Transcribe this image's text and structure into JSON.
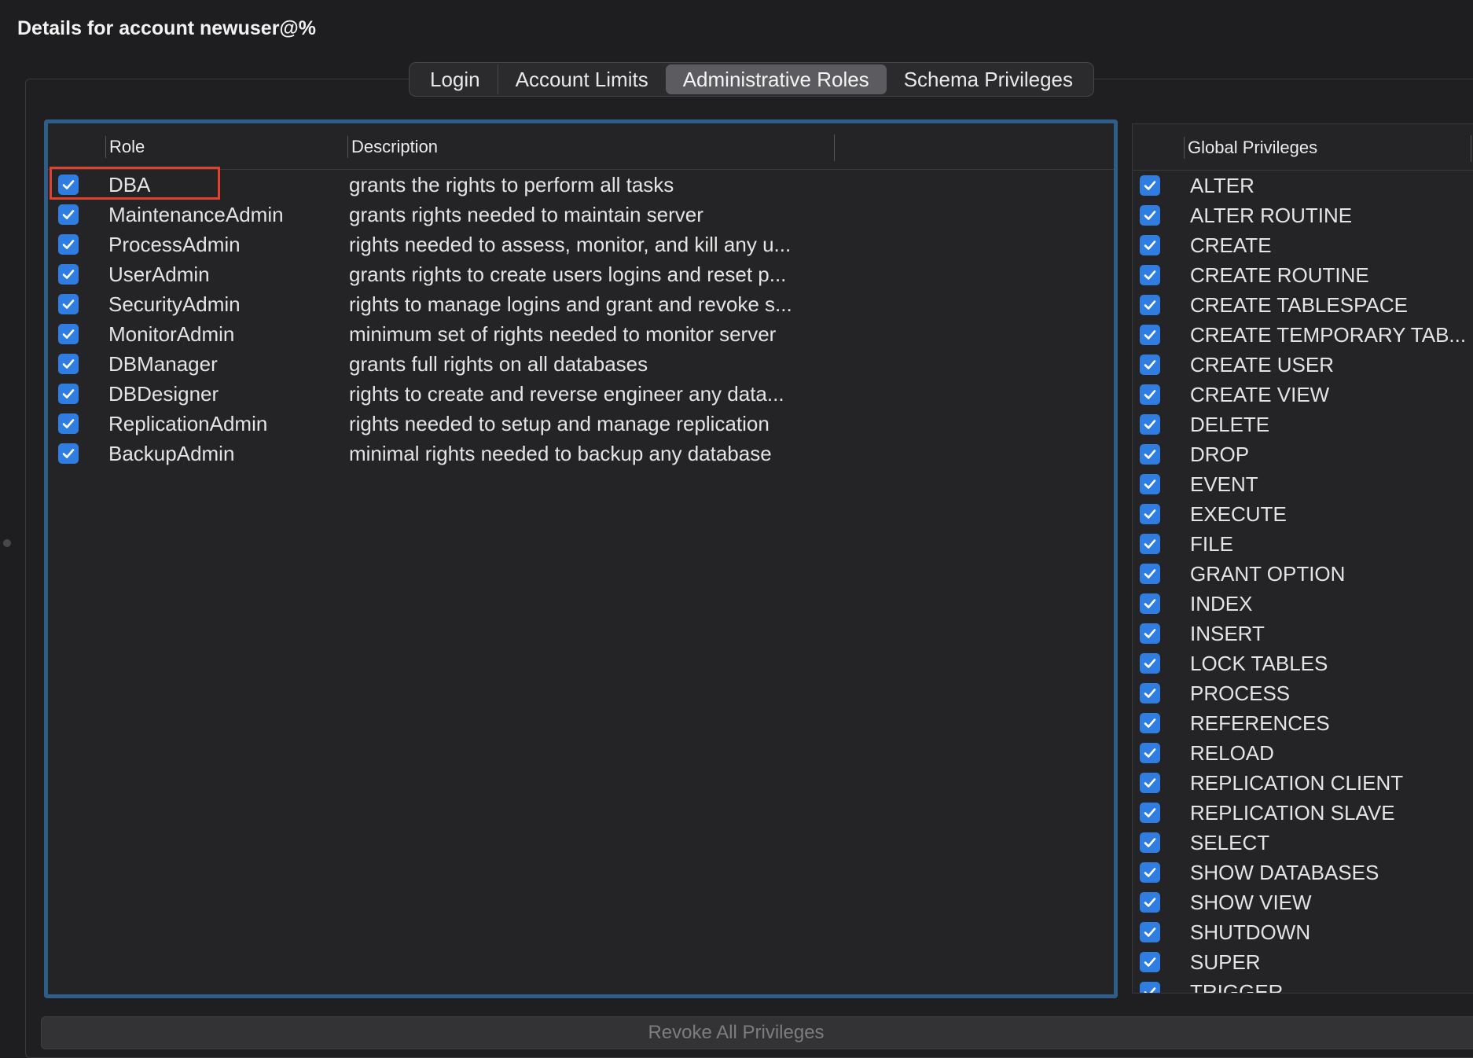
{
  "window": {
    "title": "Details for account newuser@%"
  },
  "tabs": [
    {
      "label": "Login",
      "active": false
    },
    {
      "label": "Account Limits",
      "active": false
    },
    {
      "label": "Administrative Roles",
      "active": true
    },
    {
      "label": "Schema Privileges",
      "active": false
    }
  ],
  "roles_table": {
    "columns": {
      "role": "Role",
      "description": "Description"
    },
    "rows": [
      {
        "checked": true,
        "role": "DBA",
        "description": "grants the rights to perform all tasks"
      },
      {
        "checked": true,
        "role": "MaintenanceAdmin",
        "description": "grants rights needed to maintain server"
      },
      {
        "checked": true,
        "role": "ProcessAdmin",
        "description": "rights needed to assess, monitor, and kill any u..."
      },
      {
        "checked": true,
        "role": "UserAdmin",
        "description": "grants rights to create users logins and reset p..."
      },
      {
        "checked": true,
        "role": "SecurityAdmin",
        "description": "rights to manage logins and grant and revoke s..."
      },
      {
        "checked": true,
        "role": "MonitorAdmin",
        "description": "minimum set of rights needed to monitor server"
      },
      {
        "checked": true,
        "role": "DBManager",
        "description": "grants full rights on all databases"
      },
      {
        "checked": true,
        "role": "DBDesigner",
        "description": "rights to create and reverse engineer any data..."
      },
      {
        "checked": true,
        "role": "ReplicationAdmin",
        "description": "rights needed to setup and manage replication"
      },
      {
        "checked": true,
        "role": "BackupAdmin",
        "description": "minimal rights needed to backup any database"
      }
    ]
  },
  "privileges_table": {
    "column": "Global Privileges",
    "rows": [
      {
        "checked": true,
        "name": "ALTER"
      },
      {
        "checked": true,
        "name": "ALTER ROUTINE"
      },
      {
        "checked": true,
        "name": "CREATE"
      },
      {
        "checked": true,
        "name": "CREATE ROUTINE"
      },
      {
        "checked": true,
        "name": "CREATE TABLESPACE"
      },
      {
        "checked": true,
        "name": "CREATE TEMPORARY TAB..."
      },
      {
        "checked": true,
        "name": "CREATE USER"
      },
      {
        "checked": true,
        "name": "CREATE VIEW"
      },
      {
        "checked": true,
        "name": "DELETE"
      },
      {
        "checked": true,
        "name": "DROP"
      },
      {
        "checked": true,
        "name": "EVENT"
      },
      {
        "checked": true,
        "name": "EXECUTE"
      },
      {
        "checked": true,
        "name": "FILE"
      },
      {
        "checked": true,
        "name": "GRANT OPTION"
      },
      {
        "checked": true,
        "name": "INDEX"
      },
      {
        "checked": true,
        "name": "INSERT"
      },
      {
        "checked": true,
        "name": "LOCK TABLES"
      },
      {
        "checked": true,
        "name": "PROCESS"
      },
      {
        "checked": true,
        "name": "REFERENCES"
      },
      {
        "checked": true,
        "name": "RELOAD"
      },
      {
        "checked": true,
        "name": "REPLICATION CLIENT"
      },
      {
        "checked": true,
        "name": "REPLICATION SLAVE"
      },
      {
        "checked": true,
        "name": "SELECT"
      },
      {
        "checked": true,
        "name": "SHOW DATABASES"
      },
      {
        "checked": true,
        "name": "SHOW VIEW"
      },
      {
        "checked": true,
        "name": "SHUTDOWN"
      },
      {
        "checked": true,
        "name": "SUPER"
      },
      {
        "checked": true,
        "name": "TRIGGER"
      }
    ]
  },
  "footer": {
    "revoke_label": "Revoke All Privileges"
  },
  "colors": {
    "accent": "#2f7de1",
    "focus_border": "#2f5d8a",
    "annotation": "#e0422d"
  },
  "icons": {
    "checkbox": "checkmark-icon"
  }
}
